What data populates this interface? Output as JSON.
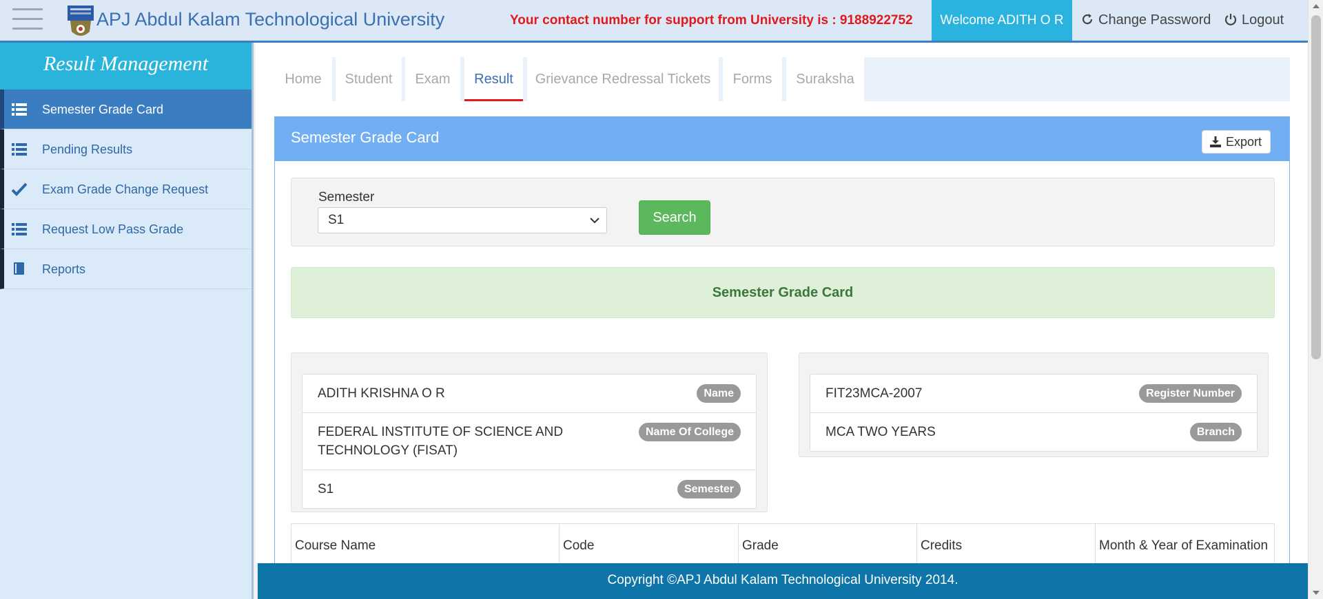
{
  "header": {
    "brand": "APJ Abdul Kalam Technological University",
    "support_text": "Your contact number for support from University is : 9188922752",
    "welcome": "Welcome ADITH O R",
    "change_password": "Change Password",
    "logout": "Logout"
  },
  "sidebar": {
    "title": "Result Management",
    "items": [
      {
        "label": "Semester Grade Card",
        "icon": "list-icon",
        "active": true
      },
      {
        "label": "Pending Results",
        "icon": "list-icon"
      },
      {
        "label": "Exam Grade Change Request",
        "icon": "check-icon"
      },
      {
        "label": "Request Low Pass Grade",
        "icon": "list-icon"
      },
      {
        "label": "Reports",
        "icon": "book-icon"
      }
    ]
  },
  "tabs": [
    {
      "label": "Home"
    },
    {
      "label": "Student"
    },
    {
      "label": "Exam"
    },
    {
      "label": "Result",
      "active": true
    },
    {
      "label": "Grievance Redressal Tickets"
    },
    {
      "label": "Forms"
    },
    {
      "label": "Suraksha"
    }
  ],
  "panel": {
    "title": "Semester Grade Card",
    "export_label": "Export",
    "filter": {
      "semester_label": "Semester",
      "semester_value": "S1",
      "search_label": "Search"
    },
    "alert_text": "Semester Grade Card",
    "student_info": {
      "left": [
        {
          "value": "ADITH KRISHNA O R",
          "badge": "Name"
        },
        {
          "value": "FEDERAL INSTITUTE OF SCIENCE AND TECHNOLOGY (FISAT)",
          "badge": "Name Of College"
        },
        {
          "value": "S1",
          "badge": "Semester"
        }
      ],
      "right": [
        {
          "value": "FIT23MCA-2007",
          "badge": "Register Number"
        },
        {
          "value": "MCA TWO YEARS",
          "badge": "Branch"
        }
      ]
    },
    "table_headers": [
      "Course Name",
      "Code",
      "Grade",
      "Credits",
      "Month & Year of Examination"
    ]
  },
  "footer": "Copyright ©APJ Abdul Kalam Technological University 2014.",
  "colors": {
    "brand_blue": "#3a6fb3",
    "support_red": "#e0191d",
    "welcome_bg": "#29b3de",
    "sidebar_active": "#3b7dc1",
    "panel_head": "#72aef2",
    "search_green": "#5cb85c",
    "footer_bg": "#0d75a8"
  }
}
